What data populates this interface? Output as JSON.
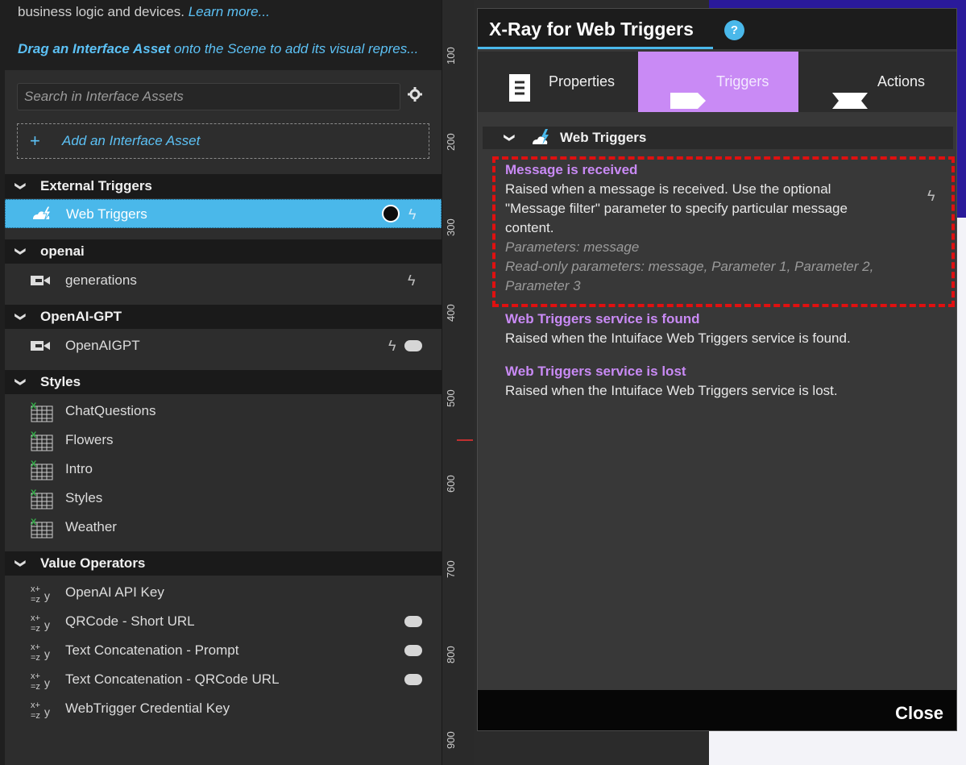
{
  "left": {
    "intro_line": "business logic and devices.",
    "learn_more": "Learn more...",
    "drag_bold": "Drag an Interface Asset",
    "drag_rest": "onto the Scene to add its visual repres...",
    "search_placeholder": "Search in Interface Assets",
    "add_asset_label": "Add an Interface Asset",
    "sections": {
      "external": "External Triggers",
      "openai": "openai",
      "openai_gpt": "OpenAI-GPT",
      "styles": "Styles",
      "value_operators": "Value Operators"
    },
    "items": {
      "web_triggers": "Web Triggers",
      "generations": "generations",
      "openaigpt": "OpenAIGPT",
      "chat_questions": "ChatQuestions",
      "flowers": "Flowers",
      "intro": "Intro",
      "styles": "Styles",
      "weather": "Weather",
      "openai_api_key": "OpenAI API Key",
      "qrcode_short": "QRCode - Short URL",
      "text_concat_prompt": "Text Concatenation - Prompt",
      "text_concat_qr": "Text Concatenation - QRCode URL",
      "webtrigger_cred": "WebTrigger Credential Key"
    }
  },
  "ruler": {
    "labels": [
      "100",
      "200",
      "300",
      "400",
      "500",
      "600",
      "700",
      "800",
      "900"
    ]
  },
  "dialog": {
    "title": "X-Ray for Web Triggers",
    "help": "?",
    "tabs": {
      "properties": "Properties",
      "triggers": "Triggers",
      "actions": "Actions"
    },
    "group_title": "Web Triggers",
    "triggers": [
      {
        "name": "Message is received",
        "desc1": "Raised when a message is received. Use the optional",
        "desc2": "\"Message filter\" parameter to specify particular message",
        "desc3": "content.",
        "params": "Parameters: message",
        "ro1": "Read-only parameters: message, Parameter 1, Parameter 2,",
        "ro2": "Parameter 3"
      },
      {
        "name": "Web Triggers service is found",
        "desc1": "Raised when the Intuiface Web Triggers service is found."
      },
      {
        "name": "Web Triggers service is lost",
        "desc1": "Raised when the Intuiface Web Triggers service is lost."
      }
    ],
    "close": "Close"
  },
  "colors": {
    "accent_blue": "#4ab8ea",
    "accent_purple": "#c98af5",
    "highlight_red": "#e01010"
  }
}
